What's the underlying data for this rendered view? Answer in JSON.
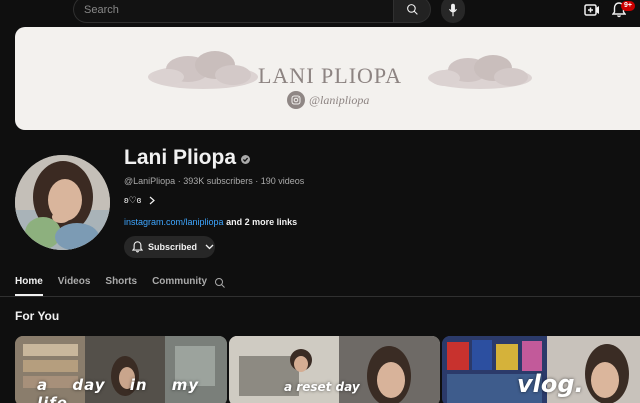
{
  "topbar": {
    "search_placeholder": "Search",
    "notification_count": "9+",
    "icons": [
      "search-icon",
      "mic-icon",
      "create-video-icon",
      "bell-icon"
    ]
  },
  "banner": {
    "title": "LANI PLIOPA",
    "handle": "@lanipliopa"
  },
  "channel": {
    "name": "Lani Pliopa",
    "handle": "@LaniPliopa",
    "subscribers": "393K subscribers",
    "videos": "190 videos",
    "description": "ʚ♡ɞ",
    "link": "instagram.com/lanipliopa",
    "more_links": "and 2 more links",
    "subscribed_label": "Subscribed"
  },
  "tabs": [
    {
      "label": "Home",
      "active": true
    },
    {
      "label": "Videos",
      "active": false
    },
    {
      "label": "Shorts",
      "active": false
    },
    {
      "label": "Community",
      "active": false
    }
  ],
  "section": {
    "title": "For You"
  },
  "thumbnails": [
    {
      "overlay_text": "a day in my life"
    },
    {
      "overlay_text": "a reset day"
    },
    {
      "overlay_text": "vlog."
    }
  ],
  "colors": {
    "background": "#0f0f0f",
    "link": "#3ea6ff",
    "badge": "#cc0000",
    "banner_bg": "#f3f1ee"
  }
}
